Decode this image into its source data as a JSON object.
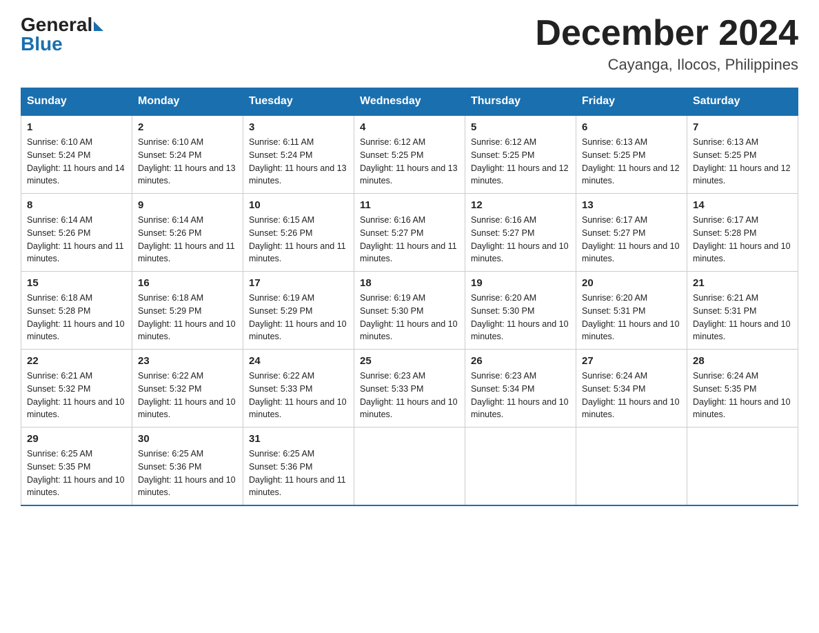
{
  "header": {
    "logo_general": "General",
    "logo_blue": "Blue",
    "month_title": "December 2024",
    "location": "Cayanga, Ilocos, Philippines"
  },
  "days_of_week": [
    "Sunday",
    "Monday",
    "Tuesday",
    "Wednesday",
    "Thursday",
    "Friday",
    "Saturday"
  ],
  "weeks": [
    [
      {
        "day": "1",
        "sunrise": "6:10 AM",
        "sunset": "5:24 PM",
        "daylight": "11 hours and 14 minutes."
      },
      {
        "day": "2",
        "sunrise": "6:10 AM",
        "sunset": "5:24 PM",
        "daylight": "11 hours and 13 minutes."
      },
      {
        "day": "3",
        "sunrise": "6:11 AM",
        "sunset": "5:24 PM",
        "daylight": "11 hours and 13 minutes."
      },
      {
        "day": "4",
        "sunrise": "6:12 AM",
        "sunset": "5:25 PM",
        "daylight": "11 hours and 13 minutes."
      },
      {
        "day": "5",
        "sunrise": "6:12 AM",
        "sunset": "5:25 PM",
        "daylight": "11 hours and 12 minutes."
      },
      {
        "day": "6",
        "sunrise": "6:13 AM",
        "sunset": "5:25 PM",
        "daylight": "11 hours and 12 minutes."
      },
      {
        "day": "7",
        "sunrise": "6:13 AM",
        "sunset": "5:25 PM",
        "daylight": "11 hours and 12 minutes."
      }
    ],
    [
      {
        "day": "8",
        "sunrise": "6:14 AM",
        "sunset": "5:26 PM",
        "daylight": "11 hours and 11 minutes."
      },
      {
        "day": "9",
        "sunrise": "6:14 AM",
        "sunset": "5:26 PM",
        "daylight": "11 hours and 11 minutes."
      },
      {
        "day": "10",
        "sunrise": "6:15 AM",
        "sunset": "5:26 PM",
        "daylight": "11 hours and 11 minutes."
      },
      {
        "day": "11",
        "sunrise": "6:16 AM",
        "sunset": "5:27 PM",
        "daylight": "11 hours and 11 minutes."
      },
      {
        "day": "12",
        "sunrise": "6:16 AM",
        "sunset": "5:27 PM",
        "daylight": "11 hours and 10 minutes."
      },
      {
        "day": "13",
        "sunrise": "6:17 AM",
        "sunset": "5:27 PM",
        "daylight": "11 hours and 10 minutes."
      },
      {
        "day": "14",
        "sunrise": "6:17 AM",
        "sunset": "5:28 PM",
        "daylight": "11 hours and 10 minutes."
      }
    ],
    [
      {
        "day": "15",
        "sunrise": "6:18 AM",
        "sunset": "5:28 PM",
        "daylight": "11 hours and 10 minutes."
      },
      {
        "day": "16",
        "sunrise": "6:18 AM",
        "sunset": "5:29 PM",
        "daylight": "11 hours and 10 minutes."
      },
      {
        "day": "17",
        "sunrise": "6:19 AM",
        "sunset": "5:29 PM",
        "daylight": "11 hours and 10 minutes."
      },
      {
        "day": "18",
        "sunrise": "6:19 AM",
        "sunset": "5:30 PM",
        "daylight": "11 hours and 10 minutes."
      },
      {
        "day": "19",
        "sunrise": "6:20 AM",
        "sunset": "5:30 PM",
        "daylight": "11 hours and 10 minutes."
      },
      {
        "day": "20",
        "sunrise": "6:20 AM",
        "sunset": "5:31 PM",
        "daylight": "11 hours and 10 minutes."
      },
      {
        "day": "21",
        "sunrise": "6:21 AM",
        "sunset": "5:31 PM",
        "daylight": "11 hours and 10 minutes."
      }
    ],
    [
      {
        "day": "22",
        "sunrise": "6:21 AM",
        "sunset": "5:32 PM",
        "daylight": "11 hours and 10 minutes."
      },
      {
        "day": "23",
        "sunrise": "6:22 AM",
        "sunset": "5:32 PM",
        "daylight": "11 hours and 10 minutes."
      },
      {
        "day": "24",
        "sunrise": "6:22 AM",
        "sunset": "5:33 PM",
        "daylight": "11 hours and 10 minutes."
      },
      {
        "day": "25",
        "sunrise": "6:23 AM",
        "sunset": "5:33 PM",
        "daylight": "11 hours and 10 minutes."
      },
      {
        "day": "26",
        "sunrise": "6:23 AM",
        "sunset": "5:34 PM",
        "daylight": "11 hours and 10 minutes."
      },
      {
        "day": "27",
        "sunrise": "6:24 AM",
        "sunset": "5:34 PM",
        "daylight": "11 hours and 10 minutes."
      },
      {
        "day": "28",
        "sunrise": "6:24 AM",
        "sunset": "5:35 PM",
        "daylight": "11 hours and 10 minutes."
      }
    ],
    [
      {
        "day": "29",
        "sunrise": "6:25 AM",
        "sunset": "5:35 PM",
        "daylight": "11 hours and 10 minutes."
      },
      {
        "day": "30",
        "sunrise": "6:25 AM",
        "sunset": "5:36 PM",
        "daylight": "11 hours and 10 minutes."
      },
      {
        "day": "31",
        "sunrise": "6:25 AM",
        "sunset": "5:36 PM",
        "daylight": "11 hours and 11 minutes."
      },
      null,
      null,
      null,
      null
    ]
  ]
}
